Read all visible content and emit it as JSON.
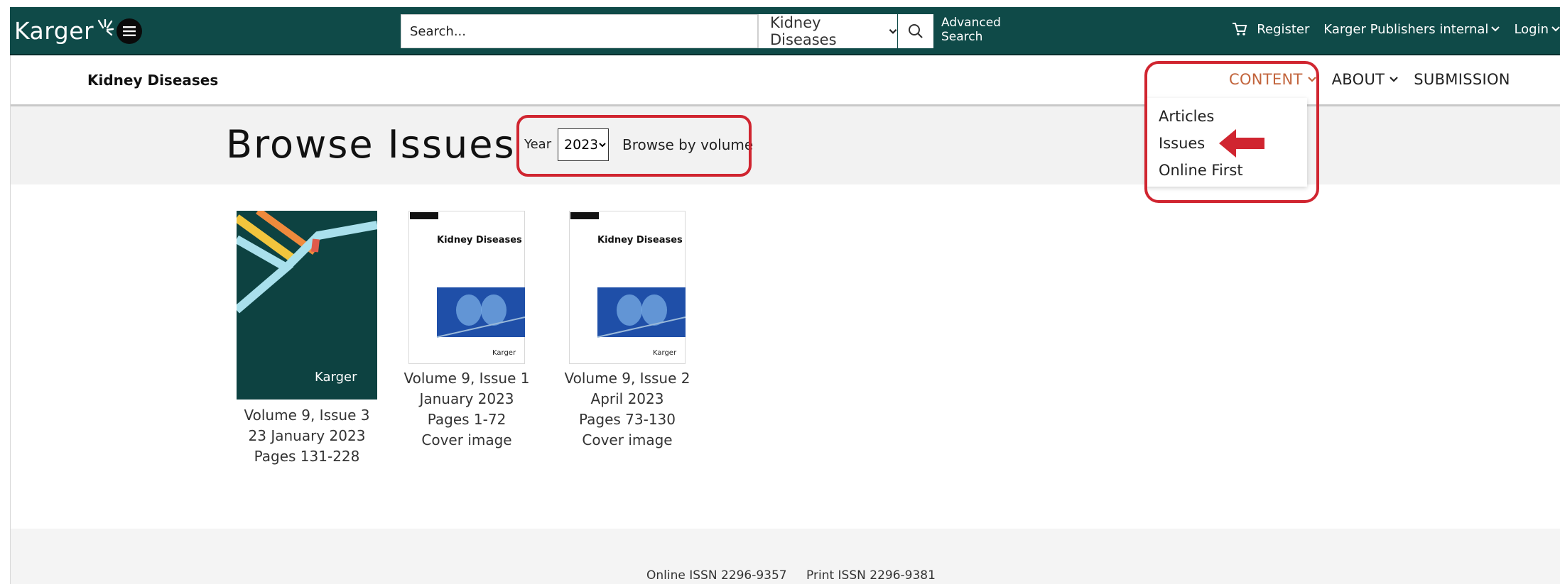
{
  "header": {
    "logo_text": "Karger",
    "search_placeholder": "Search...",
    "search_scope": "Kidney Diseases",
    "advanced_search_line1": "Advanced",
    "advanced_search_line2": "Search",
    "register": "Register",
    "publisher": "Karger Publishers internal",
    "login": "Login",
    "bg_color": "#0f4a48"
  },
  "subnav": {
    "journal_title": "Kidney Diseases",
    "items": [
      {
        "label": "CONTENT",
        "active": true,
        "color": "#c2643c"
      },
      {
        "label": "ABOUT",
        "active": false
      },
      {
        "label": "SUBMISSION",
        "active": false
      }
    ],
    "dropdown": [
      "Articles",
      "Issues",
      "Online First"
    ]
  },
  "browse": {
    "title": "Browse Issues",
    "year_label": "Year",
    "year_value": "2023",
    "browse_by_volume": "Browse by volume"
  },
  "issues": [
    {
      "volume": "Volume 9, Issue 3",
      "date": "23 January 2023",
      "pages": "Pages 131-228",
      "cover": "",
      "cover_brand": "Karger"
    },
    {
      "volume": "Volume 9, Issue 1",
      "date": "January 2023",
      "pages": "Pages 1-72",
      "cover": "Cover image",
      "cover_title": "Kidney Diseases",
      "cover_brand": "Karger"
    },
    {
      "volume": "Volume 9, Issue 2",
      "date": "April 2023",
      "pages": "Pages 73-130",
      "cover": "Cover image",
      "cover_title": "Kidney Diseases",
      "cover_brand": "Karger"
    }
  ],
  "footer": {
    "online_issn": "Online ISSN 2296-9357",
    "print_issn": "Print ISSN 2296-9381"
  },
  "annotation_color": "#d02530"
}
